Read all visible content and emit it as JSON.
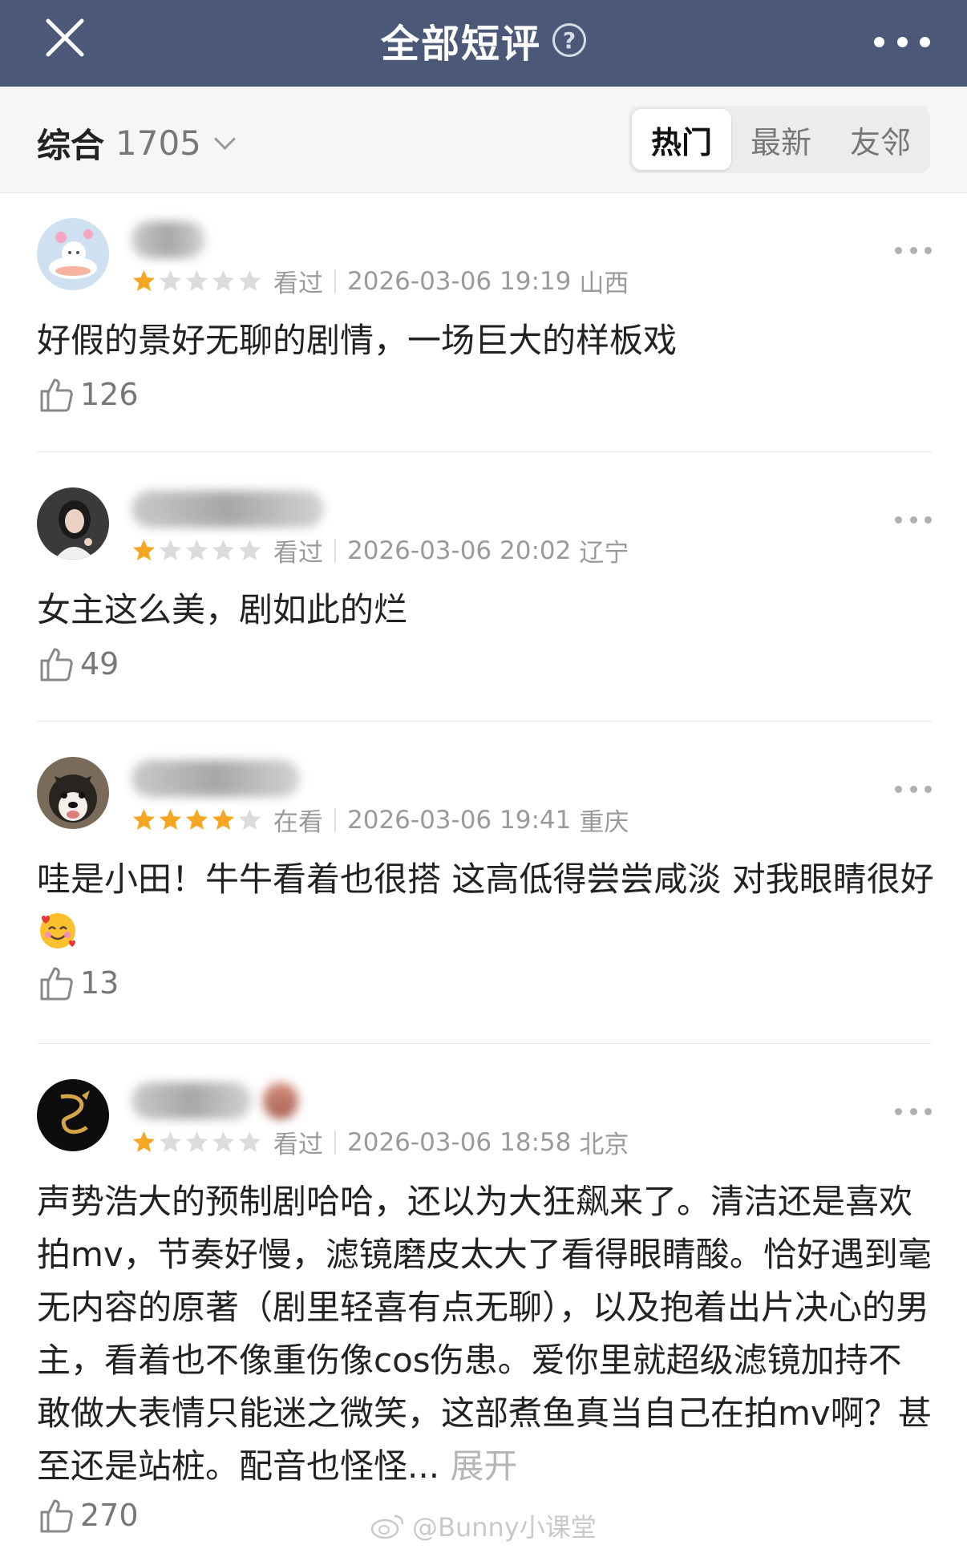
{
  "nav": {
    "title": "全部短评",
    "help_icon": "question-circle-icon",
    "close_icon": "close-icon",
    "more_icon": "more-horizontal-icon"
  },
  "filter": {
    "sort_label": "综合",
    "count": "1705",
    "tabs": [
      {
        "label": "热门",
        "active": true
      },
      {
        "label": "最新",
        "active": false
      },
      {
        "label": "友邻",
        "active": false
      }
    ]
  },
  "colors": {
    "nav_bg": "#4b5878",
    "star_filled": "#f5a623",
    "star_empty": "#dcdcdc",
    "expand_text": "#b5b5b5"
  },
  "reviews": [
    {
      "rating": 1,
      "status": "看过",
      "datetime": "2026-03-06 19:19",
      "location": "山西",
      "text": "好假的景好无聊的剧情，一场巨大的样板戏",
      "likes": "126"
    },
    {
      "rating": 1,
      "status": "看过",
      "datetime": "2026-03-06 20:02",
      "location": "辽宁",
      "text": "女主这么美，剧如此的烂",
      "likes": "49"
    },
    {
      "rating": 4,
      "status": "在看",
      "datetime": "2026-03-06 19:41",
      "location": "重庆",
      "text": "哇是小田！牛牛看着也很搭 这高低得尝尝咸淡 对我眼睛很好",
      "likes": "13"
    },
    {
      "rating": 1,
      "status": "看过",
      "datetime": "2026-03-06 18:58",
      "location": "北京",
      "text": "声势浩大的预制剧哈哈，还以为大狂飙来了。清洁还是喜欢拍mv，节奏好慢，滤镜磨皮太大了看得眼睛酸。恰好遇到毫无内容的原著（剧里轻喜有点无聊），以及抱着出片决心的男主，看着也不像重伤像cos伤患。爱你里就超级滤镜加持不敢做大表情只能迷之微笑，这部煮鱼真当自己在拍mv啊？甚至还是站桩。配音也怪怪...",
      "expand_label": "展开",
      "likes": "270"
    }
  ],
  "watermark": "@Bunny小课堂"
}
